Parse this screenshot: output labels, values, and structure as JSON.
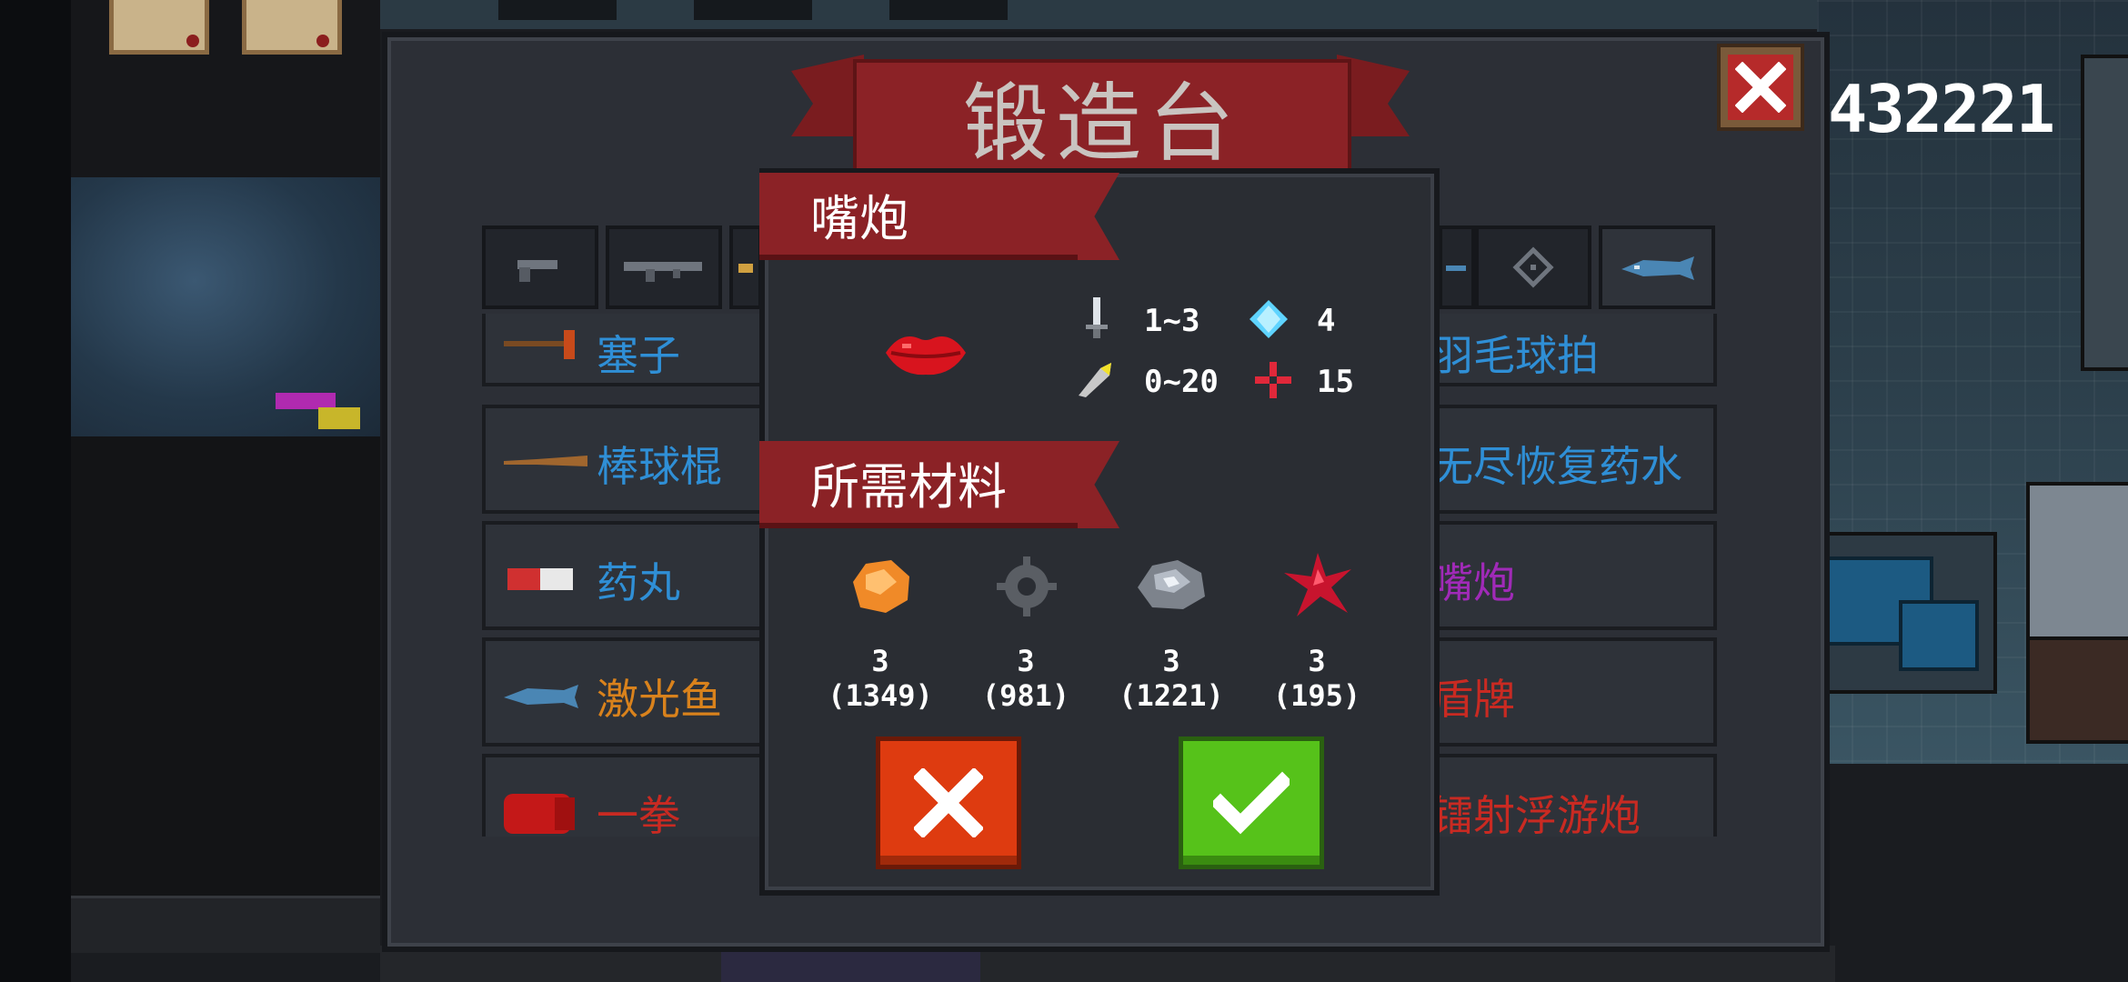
{
  "currency": {
    "amount": "432221"
  },
  "forge": {
    "title": "锻造台",
    "tabs": [
      {
        "icon": "pistol-icon"
      },
      {
        "icon": "rifle-icon"
      },
      {
        "icon": "shotgun-icon"
      },
      {
        "icon": "fish-tab-icon"
      },
      {
        "icon": "crosshair-icon"
      },
      {
        "icon": "laser-fish-icon"
      }
    ],
    "list_left": [
      {
        "name": "塞子",
        "color": "#2f8fd6",
        "icon": "plunger-icon"
      },
      {
        "name": "棒球棍",
        "color": "#2f8fd6",
        "icon": "baseball-bat-icon"
      },
      {
        "name": "药丸",
        "color": "#2f8fd6",
        "icon": "pill-icon"
      },
      {
        "name": "激光鱼",
        "color": "#d9821c",
        "icon": "laser-fish-icon"
      },
      {
        "name": "一拳",
        "color": "#c92a22",
        "icon": "fist-icon"
      }
    ],
    "list_right": [
      {
        "name": "羽毛球拍",
        "color": "#2f8fd6"
      },
      {
        "name": "无尽恢复药水",
        "color": "#2f8fd6"
      },
      {
        "name": "嘴炮",
        "color": "#a02ab8"
      },
      {
        "name": "盾牌",
        "color": "#c92a22"
      },
      {
        "name": "镭射浮游炮",
        "color": "#c92a22"
      }
    ]
  },
  "dialog": {
    "item_name": "嘴炮",
    "item_icon": "lips-icon",
    "stats": {
      "damage": "1~3",
      "energy": "4",
      "spread": "0~20",
      "crit": "15"
    },
    "materials_title": "所需材料",
    "materials": [
      {
        "icon": "orange-ore-icon",
        "need": "3",
        "have": "(1349)"
      },
      {
        "icon": "gear-part-icon",
        "need": "3",
        "have": "(981)"
      },
      {
        "icon": "iron-ore-icon",
        "need": "3",
        "have": "(1221)"
      },
      {
        "icon": "red-crystal-icon",
        "need": "3",
        "have": "(195)"
      }
    ],
    "colors": {
      "cancel": "#de3b10",
      "confirm": "#56c21a",
      "ribbon": "#8b2226"
    }
  }
}
